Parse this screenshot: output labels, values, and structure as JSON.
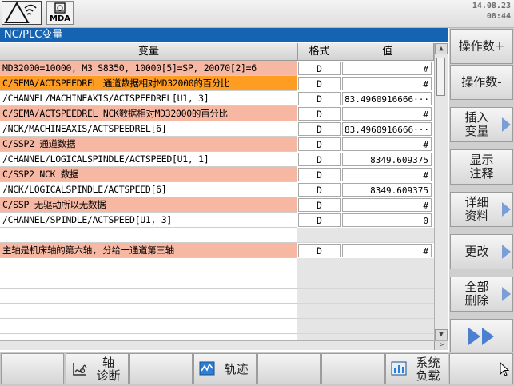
{
  "status": {
    "mode_label": "MDA",
    "date": "14.08.23",
    "time": "08:44"
  },
  "panel": {
    "title": "NC/PLC变量",
    "columns": {
      "variable": "变量",
      "format": "格式",
      "value": "值"
    }
  },
  "rows": [
    {
      "variable": "MD32000=10000, M3 S8350, 10000[5]=SP, 20070[2]=6",
      "format": "D",
      "value": "#",
      "bg": "salmon"
    },
    {
      "variable": "C/SEMA/ACTSPEEDREL 通道数据相对MD32000的百分比",
      "format": "D",
      "value": "#",
      "bg": "orange"
    },
    {
      "variable": "/CHANNEL/MACHINEAXIS/ACTSPEEDREL[U1, 3]",
      "format": "D",
      "value": "83.4960916666···",
      "bg": "white"
    },
    {
      "variable": "C/SEMA/ACTSPEEDREL NCK数据相对MD32000的百分比",
      "format": "D",
      "value": "#",
      "bg": "salmon"
    },
    {
      "variable": "/NCK/MACHINEAXIS/ACTSPEEDREL[6]",
      "format": "D",
      "value": "83.4960916666···",
      "bg": "white"
    },
    {
      "variable": "C/SSP2 通道数据",
      "format": "D",
      "value": "#",
      "bg": "salmon"
    },
    {
      "variable": "/CHANNEL/LOGICALSPINDLE/ACTSPEED[U1, 1]",
      "format": "D",
      "value": "8349.609375",
      "bg": "white"
    },
    {
      "variable": "C/SSP2 NCK 数据",
      "format": "D",
      "value": "#",
      "bg": "salmon"
    },
    {
      "variable": "/NCK/LOGICALSPINDLE/ACTSPEED[6]",
      "format": "D",
      "value": "8349.609375",
      "bg": "white"
    },
    {
      "variable": "C/SSP 无驱动所以无数据",
      "format": "D",
      "value": "#",
      "bg": "salmon"
    },
    {
      "variable": "/CHANNEL/SPINDLE/ACTSPEED[U1, 3]",
      "format": "D",
      "value": "0",
      "bg": "white"
    },
    {
      "variable": "",
      "format": "",
      "value": "",
      "bg": "white",
      "empty": true
    },
    {
      "variable": "主轴是机床轴的第六轴, 分给一通道第三轴",
      "format": "D",
      "value": "#",
      "bg": "salmon"
    },
    {
      "variable": "",
      "format": "",
      "value": "",
      "bg": "white",
      "empty": true
    },
    {
      "variable": "",
      "format": "",
      "value": "",
      "bg": "white",
      "empty": true
    },
    {
      "variable": "",
      "format": "",
      "value": "",
      "bg": "white",
      "empty": true
    },
    {
      "variable": "",
      "format": "",
      "value": "",
      "bg": "white",
      "empty": true
    },
    {
      "variable": "",
      "format": "",
      "value": "",
      "bg": "white",
      "empty": true
    },
    {
      "variable": "",
      "format": "",
      "value": "",
      "bg": "white",
      "empty": true
    }
  ],
  "vertical_softkeys": [
    {
      "label": "操作数+",
      "arrow": false
    },
    {
      "label": "操作数-",
      "arrow": false
    },
    {
      "label": "插入\n变量",
      "arrow": true
    },
    {
      "label": "显示\n注释",
      "arrow": false
    },
    {
      "label": "详细\n资料",
      "arrow": true
    },
    {
      "label": "更改",
      "arrow": true
    },
    {
      "label": "全部\n删除",
      "arrow": true
    },
    {
      "label": "",
      "arrow": false,
      "icon": "next-page-icon"
    }
  ],
  "horizontal_softkeys": [
    {
      "label": "",
      "icon": ""
    },
    {
      "label": "轴\n诊断",
      "icon": "axis-diagnosis-icon"
    },
    {
      "label": "",
      "icon": ""
    },
    {
      "label": "轨迹",
      "icon": "trace-icon"
    },
    {
      "label": "",
      "icon": ""
    },
    {
      "label": "",
      "icon": ""
    },
    {
      "label": "系统\n负载",
      "icon": "system-load-icon"
    },
    {
      "label": "",
      "icon": "cursor-icon"
    }
  ],
  "colors": {
    "title_bar": "#1563b3",
    "row_orange": "#ff9c22",
    "row_salmon": "#f7b8a3",
    "arrow": "#7c9ed6"
  }
}
